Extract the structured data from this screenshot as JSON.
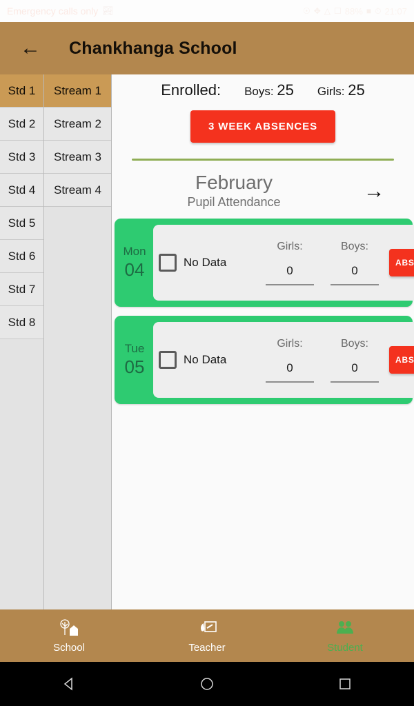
{
  "statusbar": {
    "carrier_text": "Emergency calls only",
    "carrier_icon": "shield-icon",
    "icons": [
      "location-icon",
      "bluetooth-icon",
      "wifi-icon",
      "sim-icon"
    ],
    "battery_percent": "88%",
    "battery_icon": "battery-icon",
    "alarm_icon": "alarm-icon",
    "time": "21:07"
  },
  "appbar": {
    "back_icon": "arrow-left-icon",
    "title": "Chankhanga School",
    "bg_color": "#b3874e"
  },
  "sidebar": {
    "standards": [
      {
        "label": "Std 1",
        "selected": true
      },
      {
        "label": "Std 2",
        "selected": false
      },
      {
        "label": "Std 3",
        "selected": false
      },
      {
        "label": "Std 4",
        "selected": false
      },
      {
        "label": "Std 5",
        "selected": false
      },
      {
        "label": "Std 6",
        "selected": false
      },
      {
        "label": "Std 7",
        "selected": false
      },
      {
        "label": "Std 8",
        "selected": false
      }
    ],
    "streams": [
      {
        "label": "Stream 1",
        "selected": true
      },
      {
        "label": "Stream 2",
        "selected": false
      },
      {
        "label": "Stream 3",
        "selected": false
      },
      {
        "label": "Stream 4",
        "selected": false
      }
    ]
  },
  "main": {
    "enrolled_label": "Enrolled:",
    "boys_label": "Boys:",
    "boys_count": "25",
    "girls_label": "Girls:",
    "girls_count": "25",
    "absences_button": "3 WEEK ABSENCES",
    "divider_color": "#8fad55",
    "month": "February",
    "subtitle": "Pupil Attendance",
    "next_month_icon": "arrow-right-icon",
    "days": [
      {
        "dow": "Mon",
        "date": "04",
        "checkbox_icon": "checkbox-unchecked-icon",
        "no_data_label": "No Data",
        "girls_label": "Girls:",
        "girls_value": "0",
        "boys_label": "Boys:",
        "boys_value": "0",
        "absentees_button": "ABSENTEES"
      },
      {
        "dow": "Tue",
        "date": "05",
        "checkbox_icon": "checkbox-unchecked-icon",
        "no_data_label": "No Data",
        "girls_label": "Girls:",
        "girls_value": "0",
        "boys_label": "Boys:",
        "boys_value": "0",
        "absentees_button": "ABSENTEES"
      }
    ]
  },
  "bottomnav": {
    "items": [
      {
        "label": "School",
        "icon": "tree-house-icon",
        "active": false
      },
      {
        "label": "Teacher",
        "icon": "chalkboard-icon",
        "active": false
      },
      {
        "label": "Student",
        "icon": "students-icon",
        "active": true
      }
    ],
    "active_color": "#4caf50"
  },
  "sysnav": {
    "back_icon": "triangle-back-icon",
    "home_icon": "circle-home-icon",
    "recents_icon": "square-recents-icon"
  },
  "colors": {
    "brand_brown": "#b3874e",
    "selected_tan": "#ca9a55",
    "card_green": "#2ecb71",
    "danger_red": "#f4321e",
    "divider_green": "#8fad55"
  }
}
